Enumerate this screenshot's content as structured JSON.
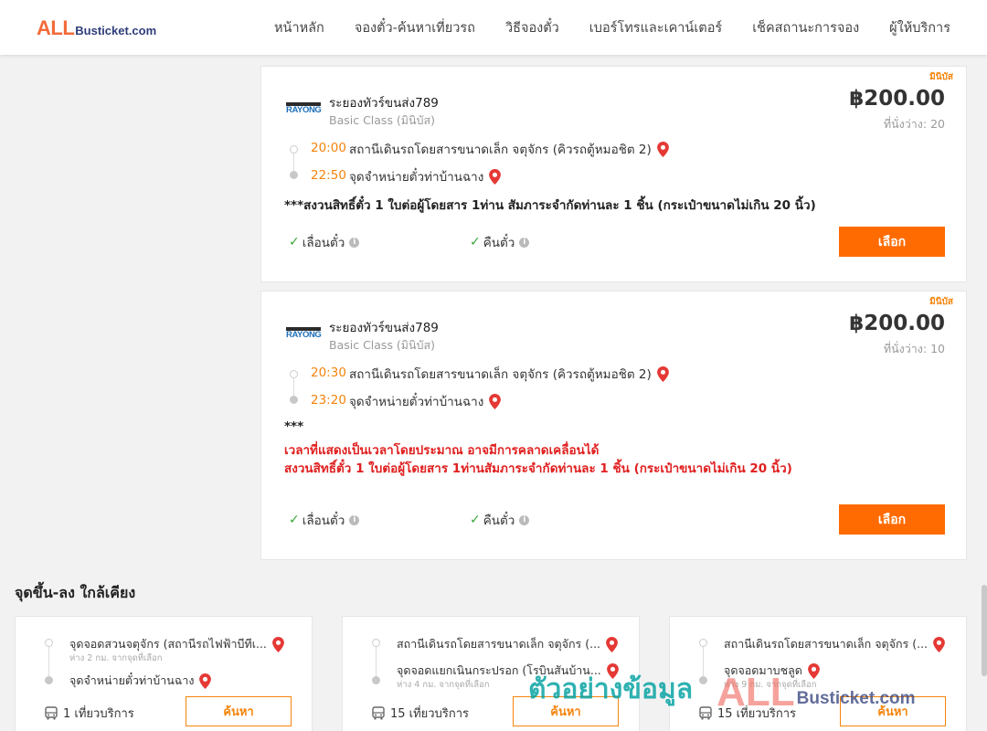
{
  "header": {
    "logo_all": "ALL",
    "logo_busticket": "Busticket.com",
    "nav": [
      {
        "label": "หน้าหลัก"
      },
      {
        "label": "จองตั๋ว-ค้นหาเที่ยวรถ"
      },
      {
        "label": "วิธีจองตั๋ว"
      },
      {
        "label": "เบอร์โทรและเคาน์เตอร์"
      },
      {
        "label": "เช็คสถานะการจอง"
      },
      {
        "label": "ผู้ให้บริการ"
      }
    ]
  },
  "trips": [
    {
      "class_tag": "มินิบัส",
      "operator_logo": "RAYONG",
      "operator": "ระยองทัวร์ขนส่ง789",
      "bus_class": "Basic Class (มินิบัส)",
      "price": "฿200.00",
      "seats": "ที่นั่งว่าง: 20",
      "depart_time": "20:00",
      "depart_place": "สถานีเดินรถโดยสารขนาดเล็ก จตุจักร (คิวรถตู้หมอชิต 2)",
      "arrive_time": "22:50",
      "arrive_place": "จุดจำหน่ายตั๋วท่าบ้านฉาง",
      "note": "***สงวนสิทธิ์ตั๋ว 1 ใบต่อผู้โดยสาร 1ท่าน สัมภาระจำกัดท่านละ 1 ชิ้น (กระเป๋าขนาดไม่เกิน 20 นิ้ว)",
      "reschedule": "เลื่อนตั๋ว",
      "refund": "คืนตั๋ว",
      "select": "เลือก"
    },
    {
      "class_tag": "มินิบัส",
      "operator_logo": "RAYONG",
      "operator": "ระยองทัวร์ขนส่ง789",
      "bus_class": "Basic Class (มินิบัส)",
      "price": "฿200.00",
      "seats": "ที่นั่งว่าง: 10",
      "depart_time": "20:30",
      "depart_place": "สถานีเดินรถโดยสารขนาดเล็ก จตุจักร (คิวรถตู้หมอชิต 2)",
      "arrive_time": "23:20",
      "arrive_place": "จุดจำหน่ายตั๋วท่าบ้านฉาง",
      "note_prefix": "***",
      "note_line1": "เวลาที่แสดงเป็นเวลาโดยประมาณ อาจมีการคลาดเคลื่อนได้",
      "note_line2": "สงวนสิทธิ์ตั๋ว 1 ใบต่อผู้โดยสาร 1ท่านสัมภาระจำกัดท่านละ 1 ชิ้น (กระเป๋าขนาดไม่เกิน 20 นิ้ว)",
      "reschedule": "เลื่อนตั๋ว",
      "refund": "คืนตั๋ว",
      "select": "เลือก"
    }
  ],
  "nearby": {
    "title": "จุดขึ้น-ลง ใกล้เคียง",
    "cards": [
      {
        "from": "จุดจอดสวนจตุจักร (สถานีรถไฟฟ้าบีทีเ...",
        "from_dist": "ห่าง 2 กม. จากจุดที่เลือก",
        "to": "จุดจำหน่ายตั๋วท่าบ้านฉาง",
        "to_dist": "",
        "count": "1 เที่ยวบริการ",
        "search": "ค้นหา"
      },
      {
        "from": "สถานีเดินรถโดยสารขนาดเล็ก จตุจักร (...",
        "from_dist": "",
        "to": "จุดจอดแยกเนินกระปรอก (โรบินสันบ้าน...",
        "to_dist": "ห่าง 4 กม. จากจุดที่เลือก",
        "count": "15 เที่ยวบริการ",
        "search": "ค้นหา"
      },
      {
        "from": "สถานีเดินรถโดยสารขนาดเล็ก จตุจักร (...",
        "from_dist": "",
        "to": "จุดจอดมาบชลูด",
        "to_dist": "ห่าง 9 กม. จากจุดที่เลือก",
        "count": "15 เที่ยวบริการ",
        "search": "ค้นหา"
      }
    ]
  },
  "watermark": {
    "thai": "ตัวอย่างข้อมูล",
    "all": "ALL",
    "busticket": "Busticket.com"
  },
  "colors": {
    "accent_orange": "#ff6b00",
    "time_orange": "#f5840c",
    "note_red": "#e02020",
    "check_green": "#3aa63a",
    "pin_red": "#e53935"
  }
}
